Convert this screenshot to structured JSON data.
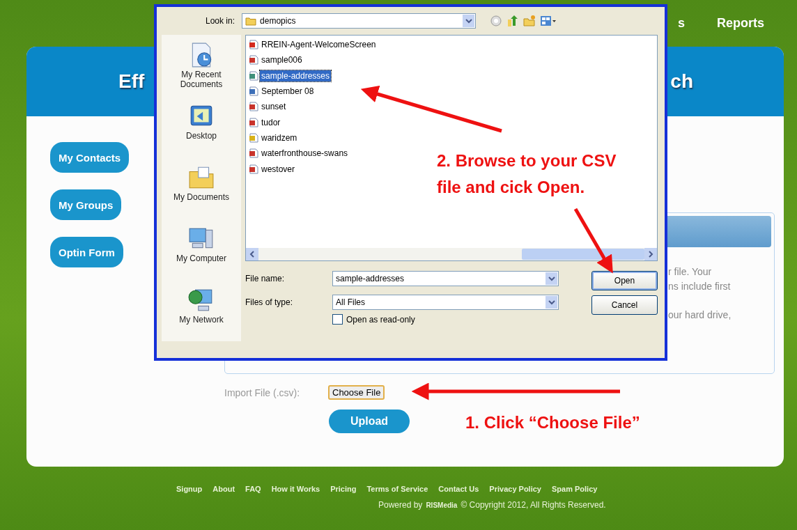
{
  "nav": [
    {
      "label": "s"
    },
    {
      "label": "Reports"
    }
  ],
  "header": {
    "title_left": "Eff",
    "title_right": "ch"
  },
  "side_buttons": [
    "My Contacts",
    "My Groups",
    "Optin Form"
  ],
  "panel": {
    "lines": [
      "r file. Your",
      "ns include first",
      "our hard drive,"
    ]
  },
  "import": {
    "label": "Import File (.csv):",
    "choose_button": "Choose File",
    "upload_button": "Upload"
  },
  "footer": {
    "links": [
      "Signup",
      "About",
      "FAQ",
      "How it Works",
      "Pricing",
      "Terms of Service",
      "Contact Us",
      "Privacy Policy",
      "Spam Policy"
    ],
    "powered_by": "Powered by",
    "brand": "RISMedia",
    "copyright": "© Copyright 2012, All Rights Reserved."
  },
  "dialog": {
    "look_in_label": "Look in:",
    "look_in_value": "demopics",
    "places": [
      {
        "label": "My Recent Documents",
        "kind": "recent"
      },
      {
        "label": "Desktop",
        "kind": "desktop"
      },
      {
        "label": "My Documents",
        "kind": "documents"
      },
      {
        "label": "My Computer",
        "kind": "computer"
      },
      {
        "label": "My Network",
        "kind": "network"
      }
    ],
    "files": [
      {
        "name": "RREIN-Agent-WelcomeScreen",
        "kind": "pdf",
        "selected": false
      },
      {
        "name": "sample006",
        "kind": "image",
        "selected": false
      },
      {
        "name": "sample-addresses",
        "kind": "sheet",
        "selected": true
      },
      {
        "name": "September 08",
        "kind": "doc",
        "selected": false
      },
      {
        "name": "sunset",
        "kind": "image",
        "selected": false
      },
      {
        "name": "tudor",
        "kind": "image",
        "selected": false
      },
      {
        "name": "waridzem",
        "kind": "archive",
        "selected": false
      },
      {
        "name": "waterfronthouse-swans",
        "kind": "image",
        "selected": false
      },
      {
        "name": "westover",
        "kind": "image",
        "selected": false
      }
    ],
    "file_name_label": "File name:",
    "file_name_value": "sample-addresses",
    "file_type_label": "Files of type:",
    "file_type_value": "All Files",
    "read_only": {
      "label": "Open as read-only",
      "checked": false
    },
    "open_button": "Open",
    "cancel_button": "Cancel"
  },
  "annotations": [
    {
      "kind": "browse",
      "text": "2. Browse to your CSV file and cick Open."
    },
    {
      "kind": "click",
      "text": "1. Click “Choose File”"
    }
  ]
}
